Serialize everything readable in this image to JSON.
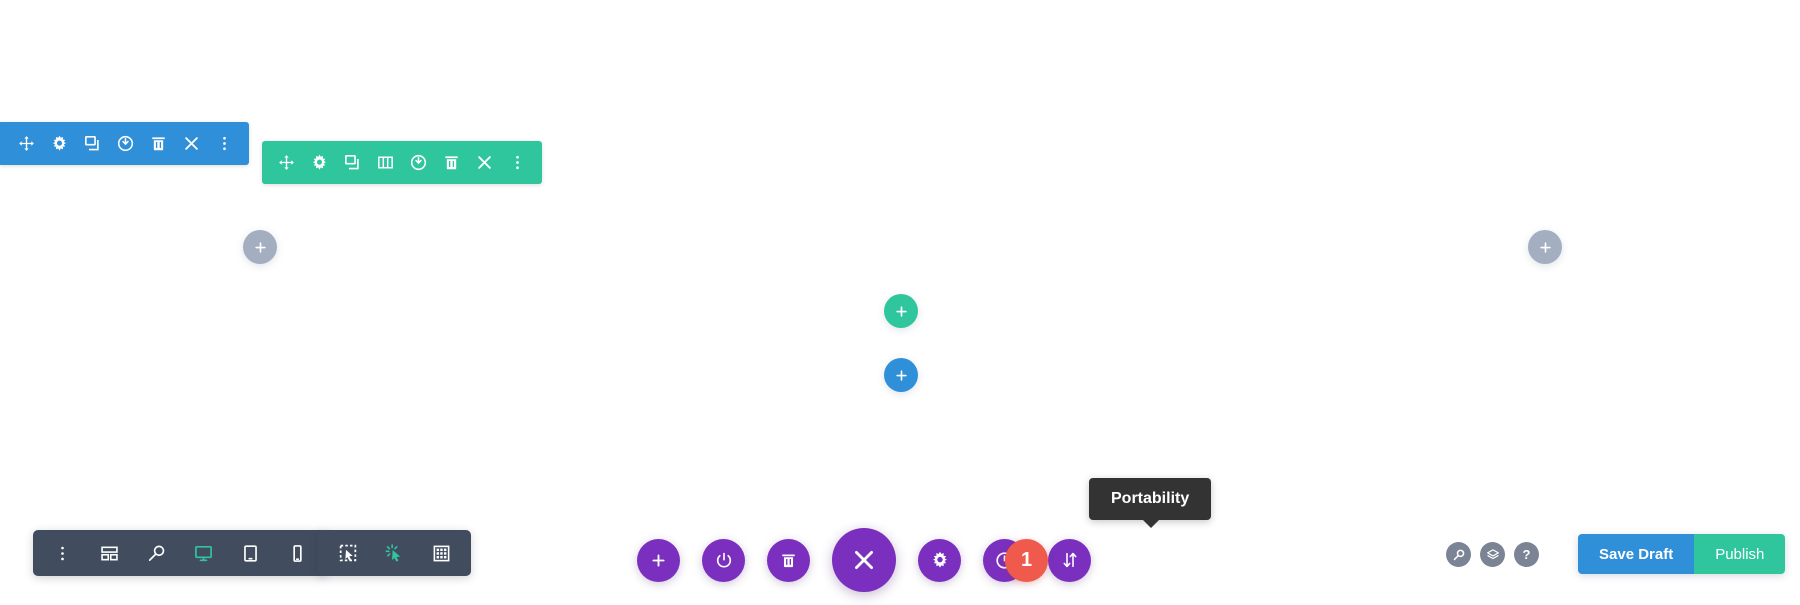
{
  "module_toolbar": {
    "name": "module-settings-toolbar",
    "color": "#2f8fd8",
    "buttons": [
      {
        "name": "move-module",
        "icon": "move-icon",
        "label": "Move Module"
      },
      {
        "name": "module-settings",
        "icon": "gear-icon",
        "label": "Module Settings"
      },
      {
        "name": "duplicate-module",
        "icon": "duplicate-icon",
        "label": "Duplicate Module"
      },
      {
        "name": "disable-module",
        "icon": "power-icon",
        "label": "Disable Module"
      },
      {
        "name": "delete-module",
        "icon": "trash-icon",
        "label": "Delete Module"
      },
      {
        "name": "close-module",
        "icon": "close-icon",
        "label": "Close"
      },
      {
        "name": "module-options",
        "icon": "kebab-menu-icon",
        "label": "Other Options"
      }
    ]
  },
  "row_toolbar": {
    "name": "row-settings-toolbar",
    "color": "#2fc69e",
    "buttons": [
      {
        "name": "move-row",
        "icon": "move-icon",
        "label": "Move Row"
      },
      {
        "name": "row-settings",
        "icon": "gear-icon",
        "label": "Row Settings"
      },
      {
        "name": "duplicate-row",
        "icon": "duplicate-icon",
        "label": "Duplicate Row"
      },
      {
        "name": "change-columns",
        "icon": "columns-icon",
        "label": "Change Column Structure"
      },
      {
        "name": "disable-row",
        "icon": "power-icon",
        "label": "Disable Row"
      },
      {
        "name": "delete-row",
        "icon": "trash-icon",
        "label": "Delete Row"
      },
      {
        "name": "close-row",
        "icon": "close-icon",
        "label": "Close"
      },
      {
        "name": "row-options",
        "icon": "kebab-menu-icon",
        "label": "Other Options"
      }
    ]
  },
  "add_buttons": [
    {
      "name": "add-section-left",
      "icon": "plus-icon",
      "color": "#a3afc1",
      "label": "Add New Section"
    },
    {
      "name": "add-section-right",
      "icon": "plus-icon",
      "color": "#a3afc1",
      "label": "Add New Section"
    },
    {
      "name": "add-row",
      "icon": "plus-icon",
      "color": "#2fc69e",
      "label": "Add New Row"
    },
    {
      "name": "add-module",
      "icon": "plus-icon",
      "color": "#2f8fd8",
      "label": "Add New Module"
    }
  ],
  "view_toolbar": {
    "name": "responsive-view-toolbar",
    "color": "#414d5e",
    "buttons": [
      {
        "name": "view-options",
        "icon": "kebab-menu-icon",
        "label": "View Options",
        "active": false
      },
      {
        "name": "wireframe-view",
        "icon": "wireframe-icon",
        "label": "Wireframe View",
        "active": false
      },
      {
        "name": "zoom-out-view",
        "icon": "zoom-icon",
        "label": "Zoom Out",
        "active": false
      },
      {
        "name": "desktop-view",
        "icon": "desktop-icon",
        "label": "Desktop View",
        "active": true
      },
      {
        "name": "tablet-view",
        "icon": "tablet-icon",
        "label": "Tablet View",
        "active": false
      },
      {
        "name": "phone-view",
        "icon": "phone-icon",
        "label": "Phone View",
        "active": false
      }
    ]
  },
  "mode_toolbar": {
    "name": "interaction-mode-toolbar",
    "color": "#414d5e",
    "buttons": [
      {
        "name": "select-mode",
        "icon": "select-cursor-icon",
        "label": "Grid / Select Mode",
        "active": false
      },
      {
        "name": "click-mode",
        "icon": "click-cursor-icon",
        "label": "Click Mode",
        "active": true
      },
      {
        "name": "grid-mode",
        "icon": "grid-icon",
        "label": "Grid Mode",
        "active": false
      }
    ]
  },
  "main_actions": {
    "name": "builder-main-actions",
    "color": "#7a2fbf",
    "buttons": [
      {
        "name": "add-new",
        "icon": "plus-icon",
        "label": "Add New",
        "size": "normal"
      },
      {
        "name": "toggle-disabled",
        "icon": "power-icon",
        "label": "Enable/Disable",
        "size": "normal"
      },
      {
        "name": "clear-layout",
        "icon": "trash-icon",
        "label": "Clear Layout",
        "size": "normal"
      },
      {
        "name": "close-builder",
        "icon": "close-icon",
        "label": "Close Builder",
        "size": "big"
      },
      {
        "name": "builder-settings",
        "icon": "gear-icon",
        "label": "Settings",
        "size": "normal"
      },
      {
        "name": "editing-history",
        "icon": "clock-icon",
        "label": "Editing History",
        "size": "normal"
      },
      {
        "name": "portability",
        "icon": "portability-icon",
        "label": "Portability",
        "size": "normal"
      }
    ],
    "history_badge": "1",
    "history_badge_color": "#ef5a4c"
  },
  "tooltip": {
    "name": "portability-tooltip",
    "text": "Portability"
  },
  "utility_icons": [
    {
      "name": "search-utility",
      "icon": "search-icon",
      "label": "Search"
    },
    {
      "name": "layers-utility",
      "icon": "layers-icon",
      "label": "Layers"
    },
    {
      "name": "help-utility",
      "icon": "help-icon",
      "label": "Help",
      "glyph": "?"
    }
  ],
  "publish_group": {
    "save_draft_label": "Save Draft",
    "save_draft_color": "#2f8fd8",
    "publish_label": "Publish",
    "publish_color": "#2fc69e"
  }
}
